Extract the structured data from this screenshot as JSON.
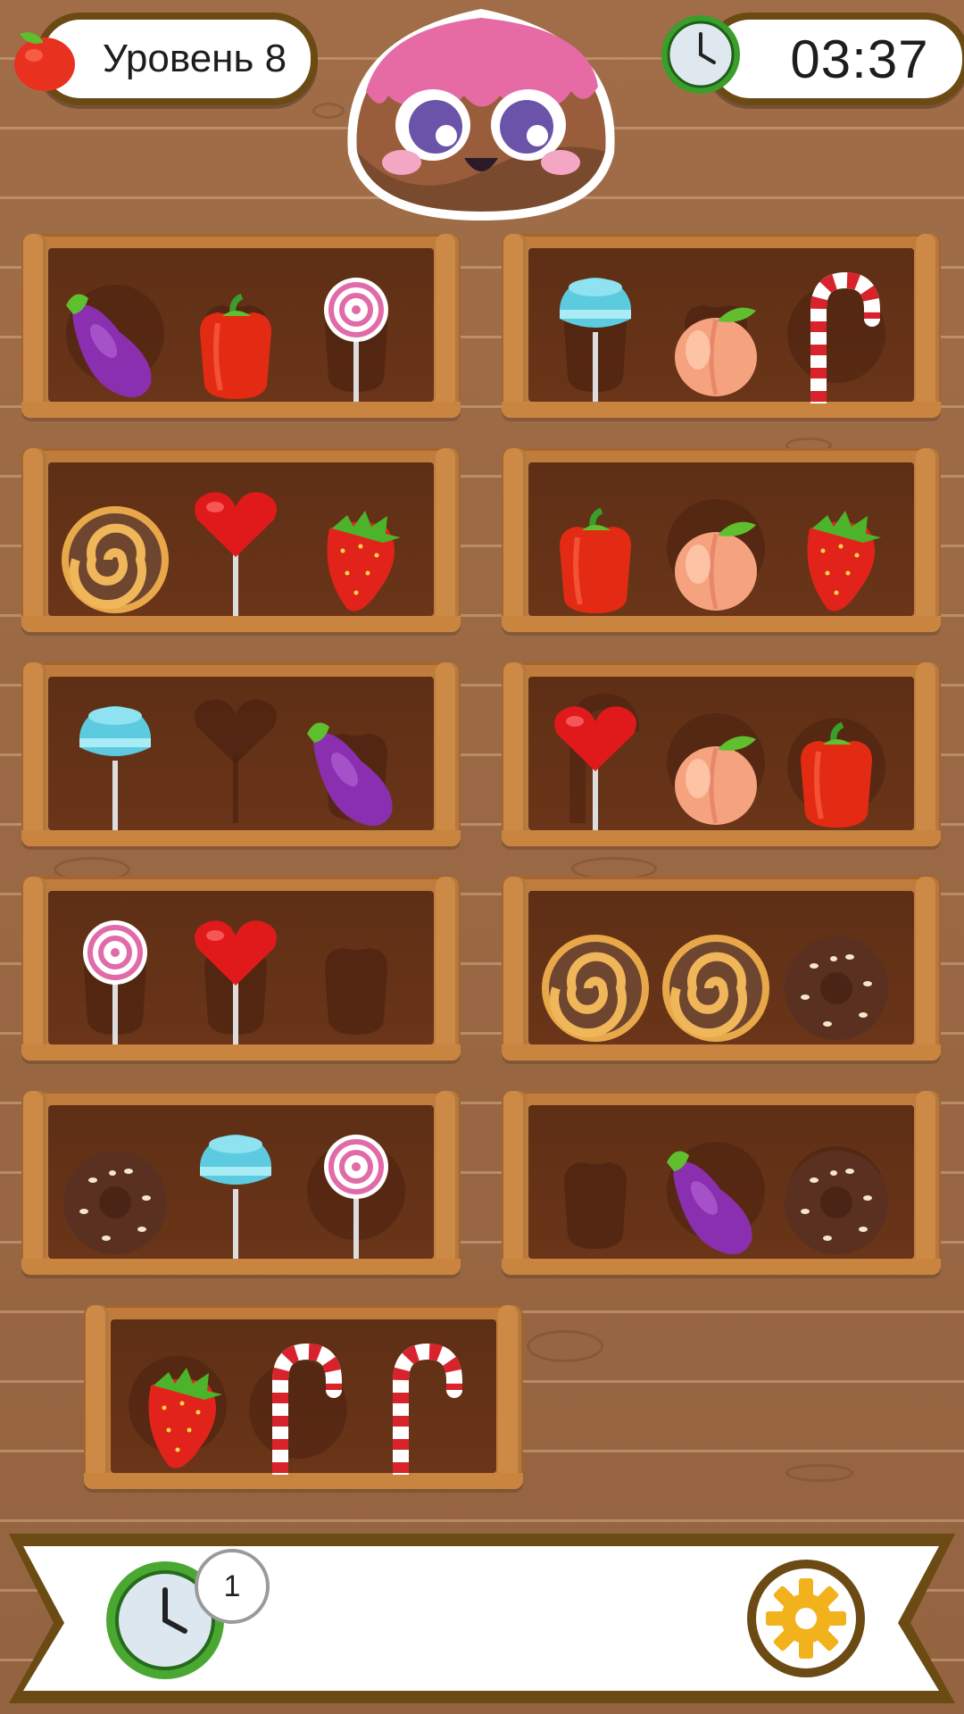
{
  "hud": {
    "level_label": "Уровень 8",
    "timer": "03:37",
    "level_icon": "apple-icon",
    "timer_icon": "clock-icon"
  },
  "mascot": {
    "name": "jelly-mascot"
  },
  "shelves": [
    {
      "items": [
        "eggplant",
        "bell-pepper",
        "pink-lollipop"
      ],
      "shadows": [
        "roll",
        "pepper",
        "pepper"
      ]
    },
    {
      "items": [
        "blue-lollipop",
        "peach",
        "candy-cane"
      ],
      "shadows": [
        "pepper",
        "pepper",
        "roll"
      ]
    },
    {
      "items": [
        "swirl-roll",
        "heart-lollipop",
        "strawberry"
      ],
      "shadows": [
        null,
        null,
        null
      ]
    },
    {
      "items": [
        "bell-pepper",
        "peach",
        "strawberry"
      ],
      "shadows": [
        null,
        "roll",
        null
      ]
    },
    {
      "items": [
        "blue-lollipop",
        null,
        "eggplant"
      ],
      "shadows": [
        null,
        "heart",
        "pepper"
      ]
    },
    {
      "items": [
        "heart-lollipop",
        "peach",
        "bell-pepper"
      ],
      "shadows": [
        "cane",
        "roll",
        "donut"
      ]
    },
    {
      "items": [
        "pink-lollipop",
        "heart-lollipop",
        null
      ],
      "shadows": [
        "pepper",
        "pepper",
        "pepper"
      ]
    },
    {
      "items": [
        "swirl-roll",
        "swirl-roll",
        "chocolate-donut"
      ],
      "shadows": [
        null,
        null,
        null
      ]
    },
    {
      "items": [
        "chocolate-donut",
        "blue-lollipop",
        "pink-lollipop"
      ],
      "shadows": [
        "pepper",
        null,
        "roll"
      ]
    },
    {
      "items": [
        null,
        "eggplant",
        "chocolate-donut"
      ],
      "shadows": [
        "pepper",
        "roll",
        "donut"
      ]
    },
    {
      "items": [
        "strawberry",
        "candy-cane",
        "candy-cane"
      ],
      "shadows": [
        "roll",
        "donut",
        null
      ]
    }
  ],
  "bottom_bar": {
    "boost_count": "1",
    "boost_icon": "clock-icon",
    "settings_icon": "gear-icon"
  },
  "colors": {
    "wood": "#9c6a44",
    "shelf": "#c07c3c",
    "shelf_inner": "#5e2f15",
    "pill_border": "#6b4a14"
  }
}
